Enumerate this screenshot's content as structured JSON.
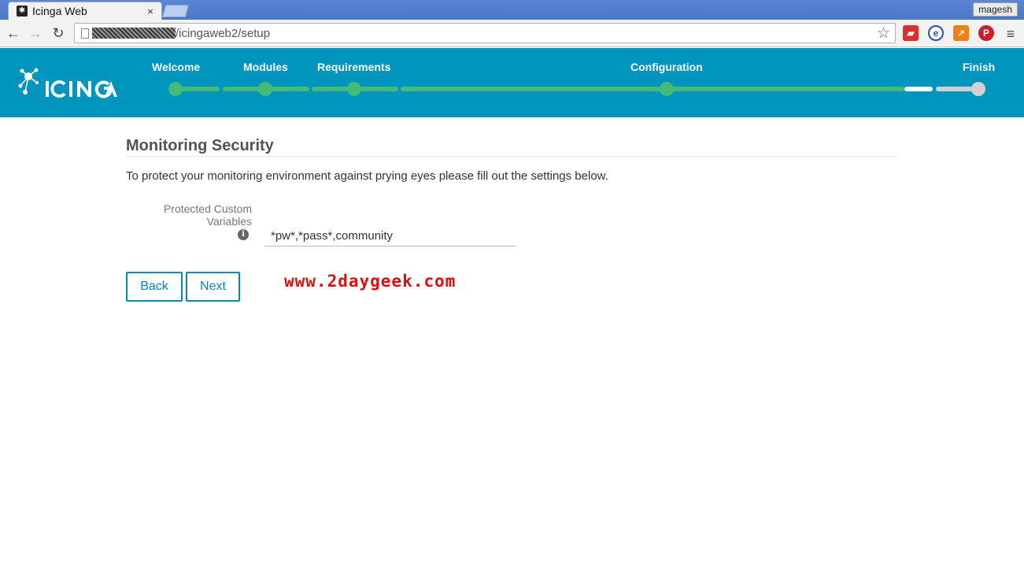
{
  "browser": {
    "tab_title": "Icinga Web",
    "tab_close": "×",
    "user": "magesh",
    "url": "/icingaweb2/setup"
  },
  "wizard": {
    "steps": [
      "Welcome",
      "Modules",
      "Requirements",
      "Configuration",
      "Finish"
    ],
    "current_step": "Finish",
    "colors": {
      "header": "#0095bf",
      "done": "#44bb77",
      "pending": "#d0d0d0"
    }
  },
  "page": {
    "title": "Monitoring Security",
    "intro": "To protect your monitoring environment against prying eyes please fill out the settings below.",
    "field_label": "Protected Custom Variables",
    "field_value": "*pw*,*pass*,community",
    "info_glyph": "i",
    "back_label": "Back",
    "next_label": "Next",
    "watermark": "www.2daygeek.com"
  }
}
